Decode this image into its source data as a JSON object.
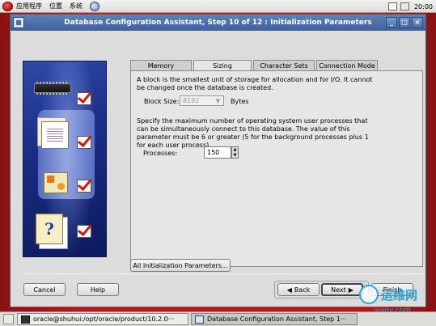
{
  "top_panel": {
    "menus": [
      "应用程序",
      "位置",
      "系统"
    ],
    "clock": "20:00"
  },
  "window": {
    "title": "Database Configuration Assistant, Step 10 of 12 : Initialization Parameters"
  },
  "tabs": [
    {
      "label": "Memory",
      "active": false
    },
    {
      "label": "Sizing",
      "active": true
    },
    {
      "label": "Character Sets",
      "active": false
    },
    {
      "label": "Connection Mode",
      "active": false
    }
  ],
  "sizing": {
    "block_desc": "A block is the smallest unit of storage for allocation and for I/O. It cannot be changed once the database is created.",
    "block_size_label": "Block Size:",
    "block_size_value": "8192",
    "block_size_unit": "Bytes",
    "processes_desc": "Specify the maximum number of operating system user processes that can be simultaneously connect to this database. The value of this parameter must be 6 or greater (5 for the background processes plus 1 for each user process).",
    "processes_label": "Processes:",
    "processes_value": "150"
  },
  "buttons": {
    "all_params": "All Initialization Parameters...",
    "cancel": "Cancel",
    "help": "Help",
    "back": "Back",
    "next": "Next",
    "finish": "Finish"
  },
  "taskbar": {
    "items": [
      "oracle@shuhui:/opt/oracle/product/10.2.0···",
      "Database Configuration Assistant, Step 1···"
    ]
  },
  "watermark": {
    "text": "运维网",
    "url": "iyunv.com"
  }
}
